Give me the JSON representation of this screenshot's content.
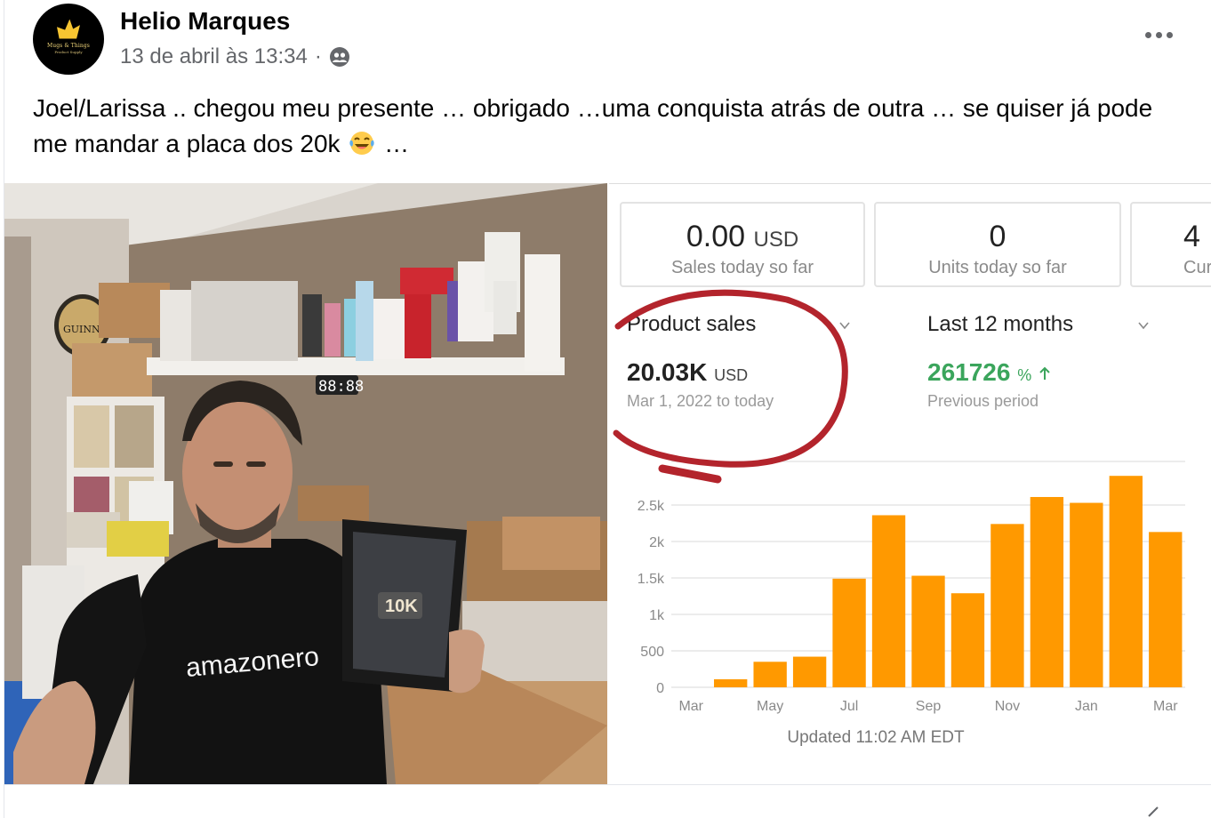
{
  "post": {
    "author": "Helio Marques",
    "timestamp": "13 de abril às 13:34",
    "separator": "·",
    "audience_icon": "friends-icon",
    "more_icon": "more-horizontal-icon",
    "avatar": {
      "logo_text": "Mugs & Things",
      "logo_sub": "Product Supply"
    },
    "text_part1": "Joel/Larissa .. chegou meu presente … obrigado …uma conquista atrás de outra … se quiser já pode me mandar a placa dos 20k",
    "emoji": "laughing-crying-emoji",
    "text_part2": "…"
  },
  "photo": {
    "shirt_text": "amazonero",
    "plaque_text": "10K",
    "clock_text": "88:88",
    "sign_text": "GUINN"
  },
  "dashboard": {
    "cards": [
      {
        "value": "0.00",
        "unit": "USD",
        "label": "Sales today so far"
      },
      {
        "value": "0",
        "unit": "",
        "label": "Units today so far"
      },
      {
        "value": "4",
        "unit": "",
        "label": "Cur"
      }
    ],
    "metric_left": {
      "title": "Product sales",
      "value": "20.03K",
      "unit": "USD",
      "sub": "Mar 1, 2022 to today"
    },
    "metric_right": {
      "title": "Last 12 months",
      "value": "261726",
      "unit": "%",
      "sub": "Previous period"
    },
    "updated": "Updated 11:02 AM EDT",
    "colors": {
      "bar": "#ff9900",
      "growth": "#3ba55c",
      "circle": "#b3242c"
    }
  },
  "chart_data": {
    "type": "bar",
    "categories": [
      "Mar",
      "Apr",
      "May",
      "Jun",
      "Jul",
      "Aug",
      "Sep",
      "Oct",
      "Nov",
      "Dec",
      "Jan",
      "Feb",
      "Mar"
    ],
    "x_tick_labels": [
      "Mar",
      "May",
      "Jul",
      "Sep",
      "Nov",
      "Jan",
      "Mar"
    ],
    "values": [
      0,
      110,
      350,
      420,
      1490,
      2360,
      1530,
      1290,
      2240,
      2610,
      2530,
      2900,
      2130
    ],
    "y_ticks": [
      0,
      500,
      1000,
      1500,
      2000,
      2500
    ],
    "y_tick_labels": [
      "0",
      "500",
      "1k",
      "1.5k",
      "2k",
      "2.5k"
    ],
    "ylim": [
      0,
      3000
    ],
    "grid": true,
    "title": "",
    "xlabel": "",
    "ylabel": ""
  }
}
